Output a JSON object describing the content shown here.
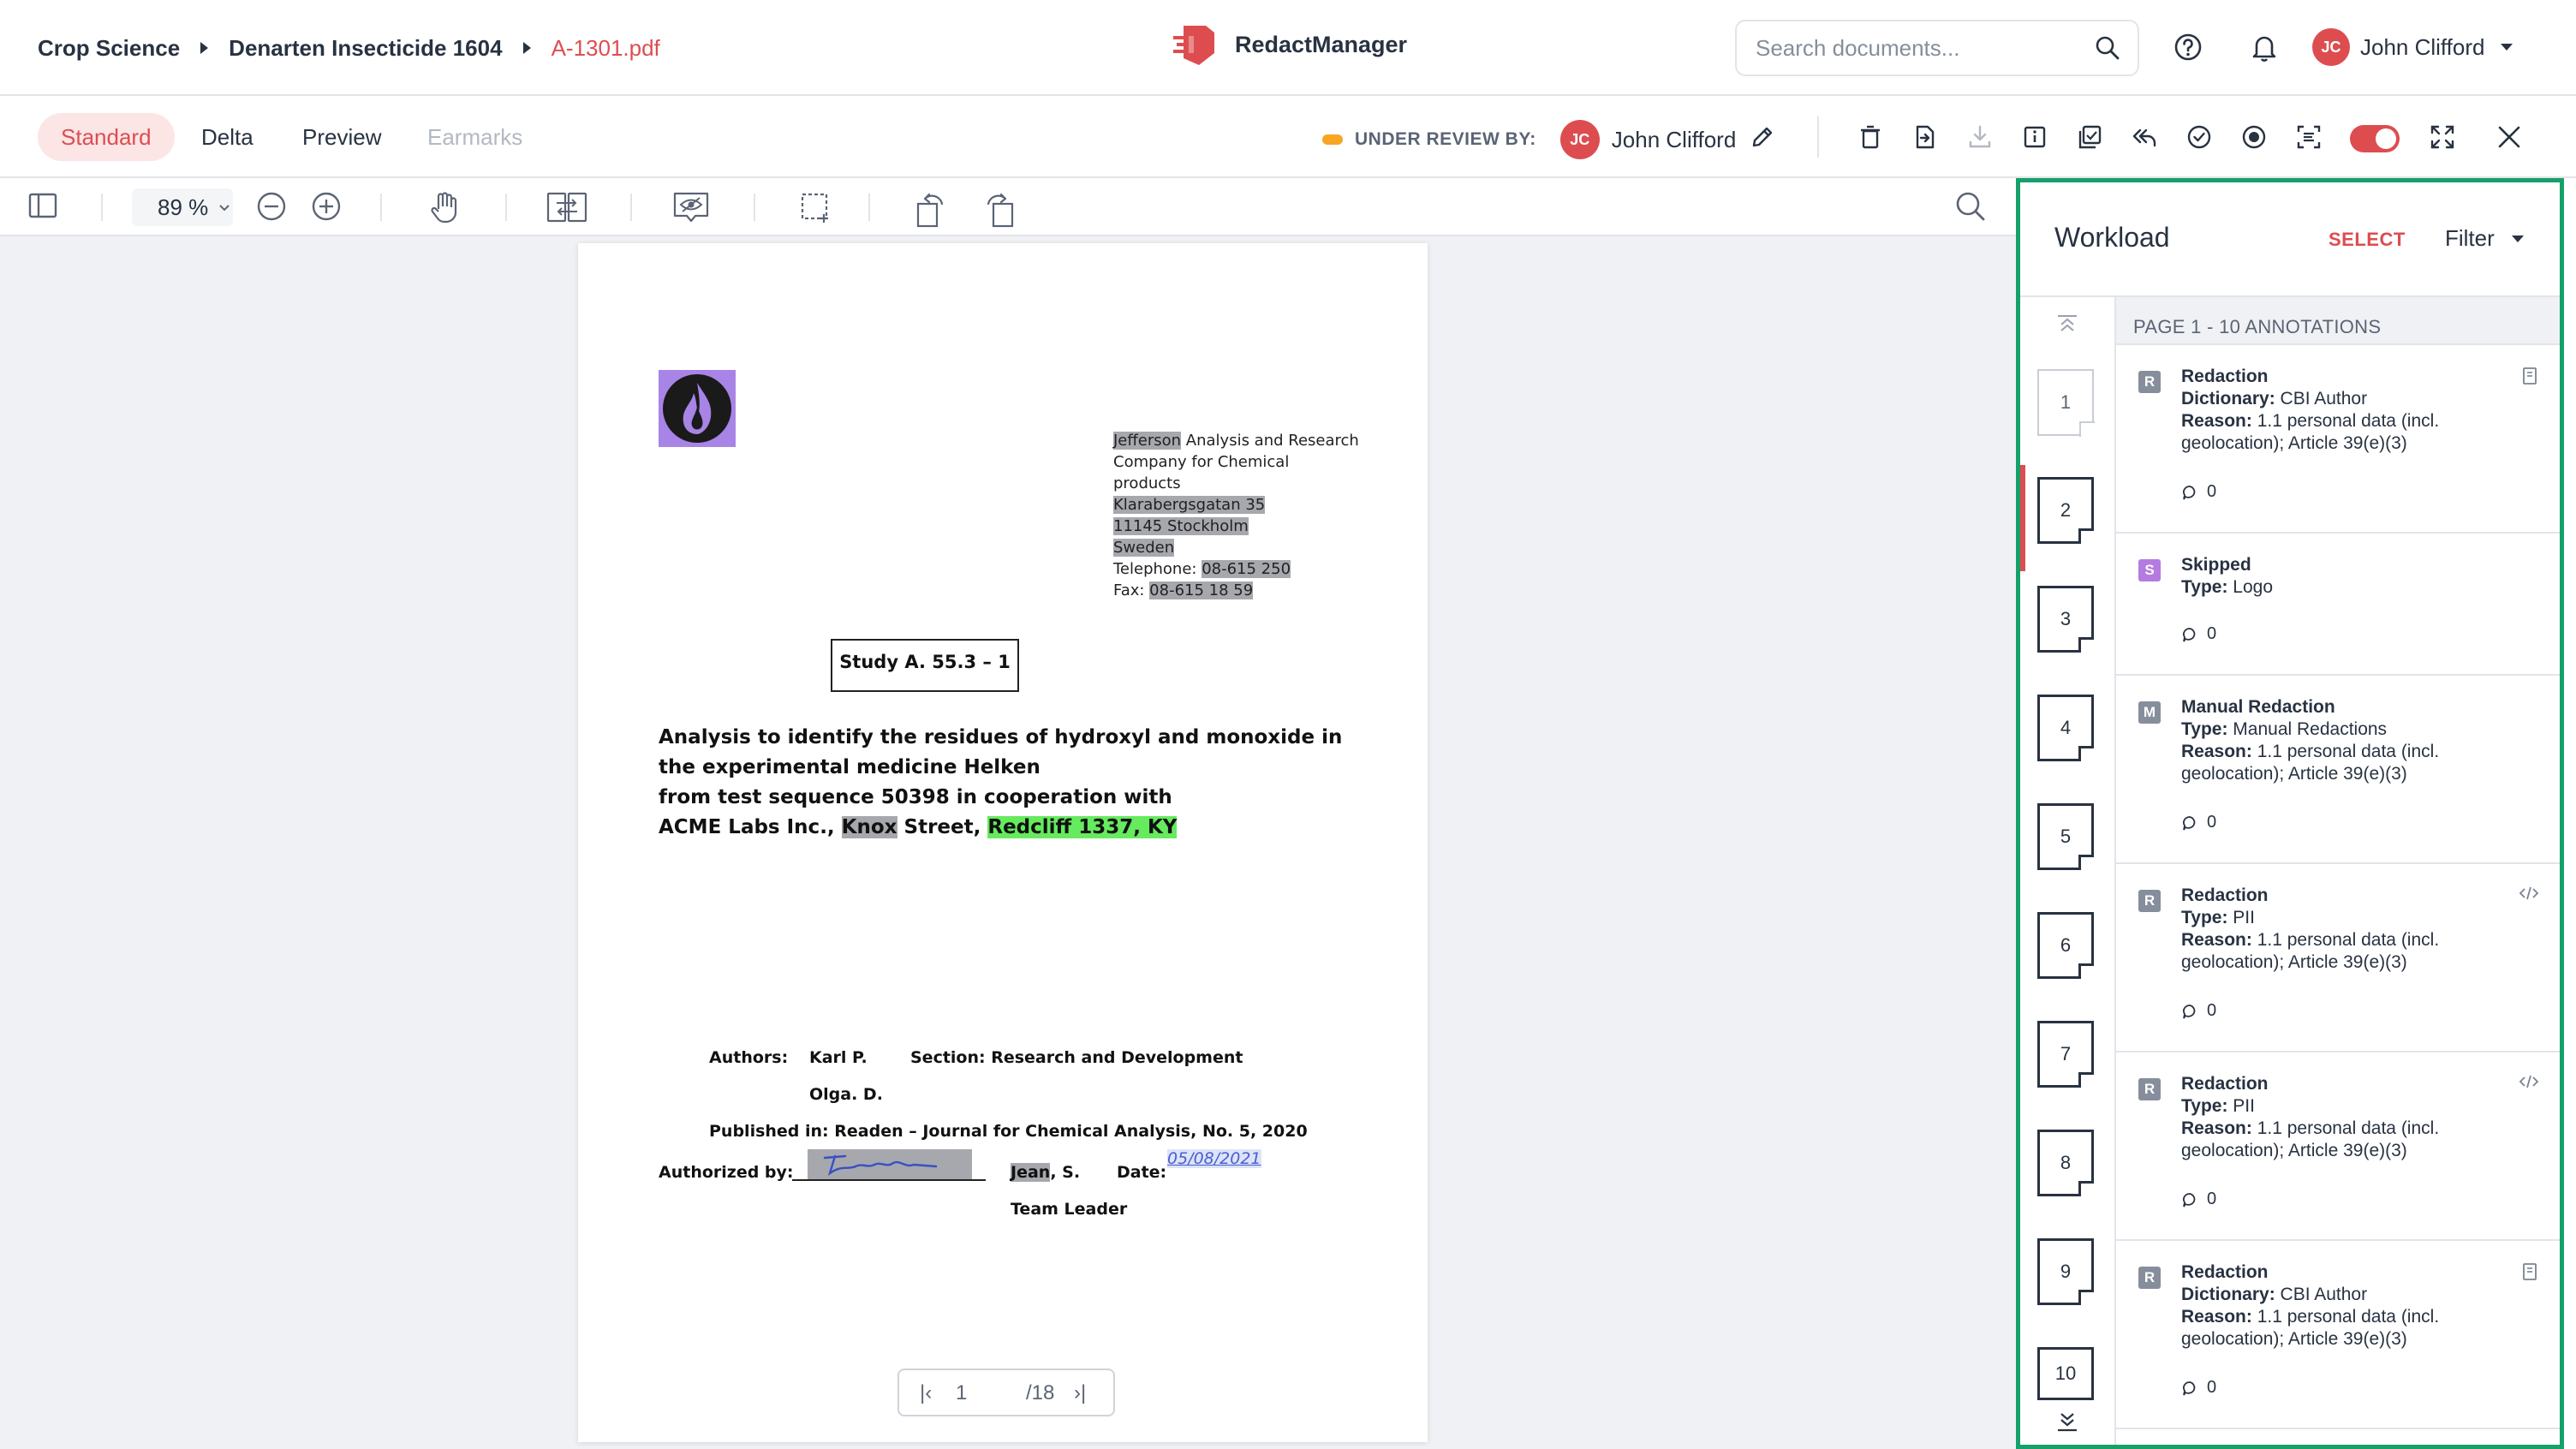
{
  "breadcrumb": {
    "items": [
      "Crop Science",
      "Denarten Insecticide 1604"
    ],
    "current": "A-1301.pdf"
  },
  "brand": {
    "name": "RedactManager"
  },
  "search": {
    "placeholder": "Search documents..."
  },
  "user": {
    "initials": "JC",
    "name": "John Clifford"
  },
  "view_tabs": [
    {
      "label": "Standard",
      "active": true
    },
    {
      "label": "Delta"
    },
    {
      "label": "Preview"
    },
    {
      "label": "Earmarks",
      "disabled": true
    }
  ],
  "review": {
    "status_label": "UNDER REVIEW BY:",
    "reviewer_initials": "JC",
    "reviewer_name": "John Clifford"
  },
  "pdf_toolbar": {
    "zoom": "89 %"
  },
  "document": {
    "address": {
      "company_name": "Jefferson",
      "line1_rest": " Analysis and Research",
      "line2": "Company for Chemical",
      "line3": "products",
      "street": "Klarabergsgatan 35",
      "city": "11145 Stockholm",
      "country": "Sweden",
      "telephone_label": "Telephone: ",
      "telephone": "08-615 250",
      "fax_label": "Fax: ",
      "fax": "08-615 18 59"
    },
    "study_box": "Study A. 55.3 – 1",
    "title": {
      "line1": "Analysis to identify the residues of hydroxyl and monoxide in",
      "line2": "the experimental medicine Helken",
      "line3": "from test sequence 50398 in cooperation with",
      "line4_prefix": "ACME Labs Inc., ",
      "line4_street": "Knox",
      "line4_mid": " Street, ",
      "line4_city": "Redcliff 1337, KY"
    },
    "authors_label": "Authors:",
    "author1": "Karl P.",
    "author2": "Olga. D.",
    "section": "Section: Research and Development",
    "published": "Published in: Readen – Journal for Chemical Analysis, No. 5, 2020",
    "authorized_label": "Authorized by:",
    "authorized_name": "Jean",
    "authorized_initial": ", S.",
    "date_label": "Date:",
    "date_value": "05/08/2021",
    "team_leader": "Team Leader",
    "current_page": "1",
    "total_pages": "/18"
  },
  "workload": {
    "title": "Workload",
    "select_label": "SELECT",
    "filter_label": "Filter",
    "annotations_header": "PAGE 1 - 10 ANNOTATIONS",
    "pages": [
      "1",
      "2",
      "3",
      "4",
      "5",
      "6",
      "7",
      "8",
      "9",
      "10"
    ],
    "annotations": [
      {
        "badge": "R",
        "title": "Redaction",
        "k1": "Dictionary:",
        "v1": " CBI Author",
        "k2": "Reason:",
        "v2": " 1.1 personal data (incl. geolocation); Article 39(e)(3)",
        "comments": "0"
      },
      {
        "badge": "S",
        "title": "Skipped",
        "k1": "Type:",
        "v1": " Logo",
        "comments": "0"
      },
      {
        "badge": "M",
        "title": "Manual Redaction",
        "k1": "Type:",
        "v1": " Manual Redactions",
        "k2": "Reason:",
        "v2": " 1.1 personal data (incl. geolocation); Article 39(e)(3)",
        "comments": "0"
      },
      {
        "badge": "R",
        "title": "Redaction",
        "k1": "Type:",
        "v1": " PII",
        "k2": "Reason:",
        "v2": " 1.1 personal data (incl. geolocation); Article 39(e)(3)",
        "comments": "0"
      },
      {
        "badge": "R",
        "title": "Redaction",
        "k1": "Type:",
        "v1": " PII",
        "k2": "Reason:",
        "v2": " 1.1 personal data (incl. geolocation); Article 39(e)(3)",
        "comments": "0"
      },
      {
        "badge": "R",
        "title": "Redaction",
        "k1": "Dictionary:",
        "v1": " CBI Author",
        "k2": "Reason:",
        "v2": " 1.1 personal data (incl. geolocation); Article 39(e)(3)",
        "comments": "0"
      }
    ]
  },
  "colors": {
    "accent": "#dd4d50",
    "panel_border": "#16a06a",
    "highlight_grey": "#a6a8ad",
    "highlight_green": "#66ea5e",
    "status_orange": "#f6a623"
  }
}
